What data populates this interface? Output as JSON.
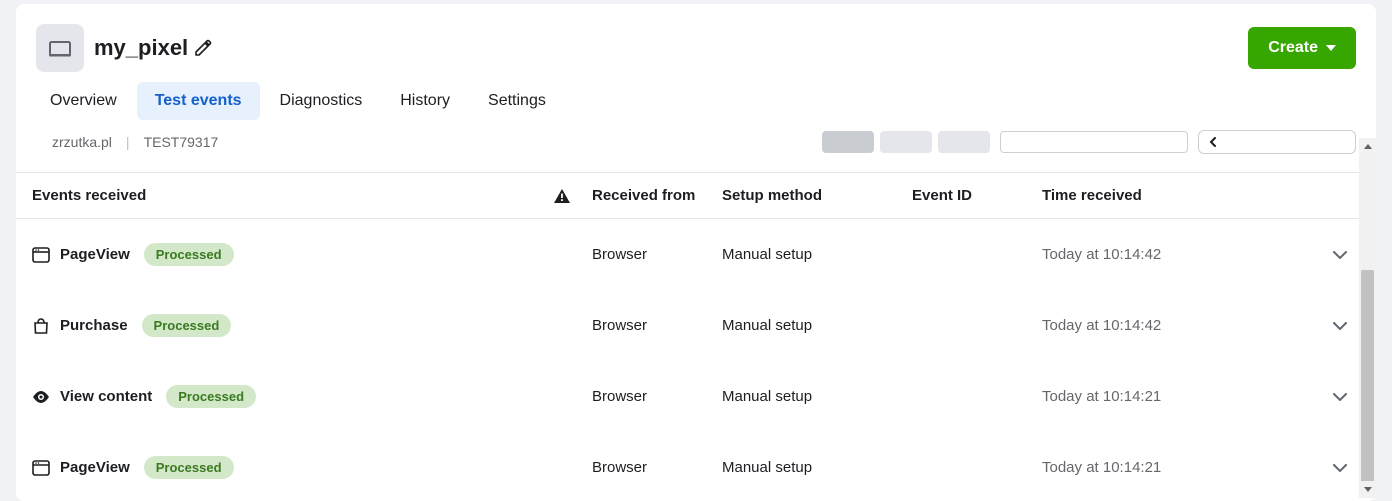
{
  "header": {
    "title": "my_pixel",
    "create_label": "Create"
  },
  "tabs": {
    "items": [
      {
        "label": "Overview"
      },
      {
        "label": "Test events"
      },
      {
        "label": "Diagnostics"
      },
      {
        "label": "History"
      },
      {
        "label": "Settings"
      }
    ]
  },
  "subheader": {
    "domain": "zrzutka.pl",
    "test_id": "TEST79317"
  },
  "table": {
    "headers": {
      "events": "Events received",
      "received_from": "Received from",
      "setup_method": "Setup method",
      "event_id": "Event ID",
      "time_received": "Time received"
    },
    "rows": [
      {
        "icon": "window",
        "name": "PageView",
        "badge": "Processed",
        "from": "Browser",
        "setup": "Manual setup",
        "event_id": "",
        "time": "Today at 10:14:42"
      },
      {
        "icon": "bag",
        "name": "Purchase",
        "badge": "Processed",
        "from": "Browser",
        "setup": "Manual setup",
        "event_id": "",
        "time": "Today at 10:14:42"
      },
      {
        "icon": "eye",
        "name": "View content",
        "badge": "Processed",
        "from": "Browser",
        "setup": "Manual setup",
        "event_id": "",
        "time": "Today at 10:14:21"
      },
      {
        "icon": "window",
        "name": "PageView",
        "badge": "Processed",
        "from": "Browser",
        "setup": "Manual setup",
        "event_id": "",
        "time": "Today at 10:14:21"
      }
    ]
  }
}
